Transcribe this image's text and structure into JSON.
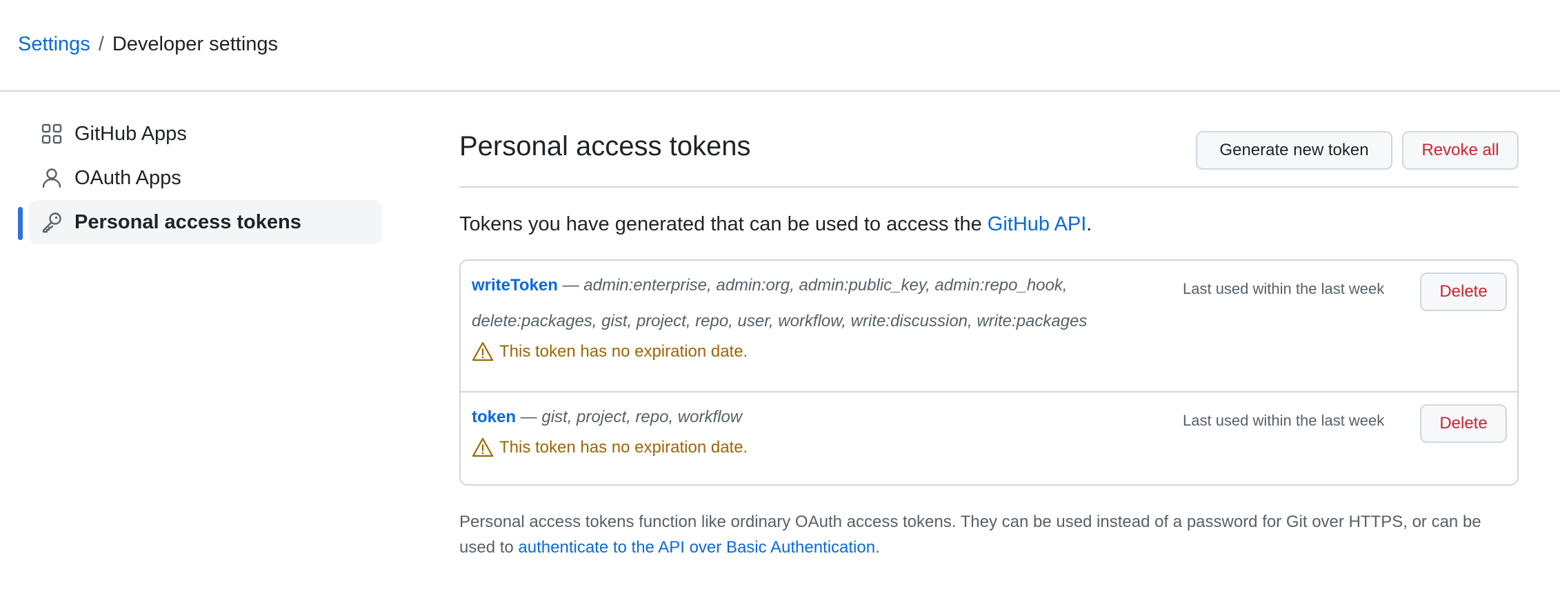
{
  "breadcrumb": {
    "root": "Settings",
    "separator": "/",
    "current": "Developer settings"
  },
  "sidebar": {
    "items": [
      {
        "label": "GitHub Apps",
        "icon": "apps-grid-icon",
        "active": false
      },
      {
        "label": "OAuth Apps",
        "icon": "person-icon",
        "active": false
      },
      {
        "label": "Personal access tokens",
        "icon": "key-icon",
        "active": true
      }
    ]
  },
  "main": {
    "title": "Personal access tokens",
    "generate_label": "Generate new token",
    "revoke_label": "Revoke all",
    "intro_prefix": "Tokens you have generated that can be used to access the ",
    "intro_link": "GitHub API",
    "intro_suffix": ".",
    "tokens": [
      {
        "name": "writeToken",
        "dash": " — ",
        "scopes": "admin:enterprise, admin:org, admin:public_key, admin:repo_hook, delete:packages, gist, project, repo, user, workflow, write:discussion, write:packages",
        "warning": "This token has no expiration date.",
        "last_used": "Last used within the last week",
        "delete_label": "Delete"
      },
      {
        "name": "token",
        "dash": " — ",
        "scopes": "gist, project, repo, workflow",
        "warning": "This token has no expiration date.",
        "last_used": "Last used within the last week",
        "delete_label": "Delete"
      }
    ],
    "footnote_prefix": "Personal access tokens function like ordinary OAuth access tokens. They can be used instead of a password for Git over HTTPS, or can be used to ",
    "footnote_link": "authenticate to the API over Basic Authentication",
    "footnote_suffix": "."
  },
  "colors": {
    "link": "#0969da",
    "danger": "#cf222e",
    "warning": "#9a6700",
    "active_indicator": "#2f6fe0"
  }
}
